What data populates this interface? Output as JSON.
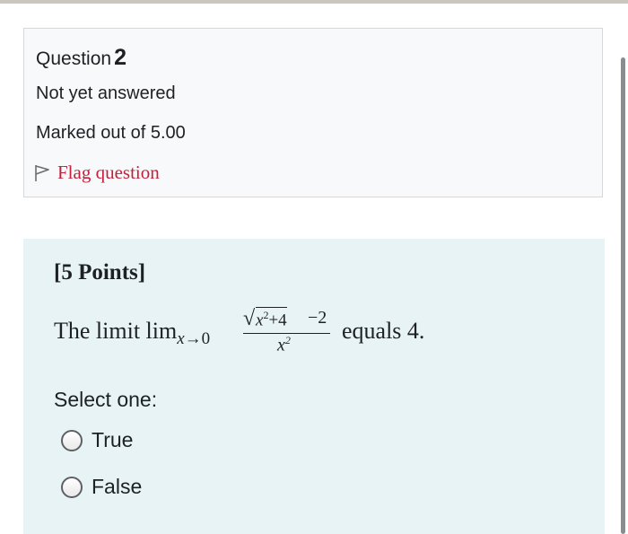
{
  "question_info": {
    "label": "Question",
    "number": "2",
    "state": "Not yet answered",
    "grade": "Marked out of 5.00",
    "flag_label": "Flag question"
  },
  "content": {
    "points": "[5 Points]",
    "question": {
      "lead": "The limit lim",
      "subscript_var": "x",
      "subscript_rest": "→0",
      "numerator": {
        "radicand_var": "x",
        "radicand_exp": "2",
        "radicand_rest": "+4",
        "after_root": "−2"
      },
      "denominator": {
        "var": "x",
        "exp": "2"
      },
      "tail": "equals 4."
    },
    "prompt": "Select one:",
    "options": [
      {
        "label": "True",
        "selected": false
      },
      {
        "label": "False",
        "selected": false
      }
    ]
  },
  "colors": {
    "flag_text": "#c4203b",
    "info_background": "#f8f9fa",
    "content_background": "#e7f3f5"
  },
  "icons": {
    "flag": "flag-outline-icon",
    "radio": "radio-unchecked-icon"
  }
}
